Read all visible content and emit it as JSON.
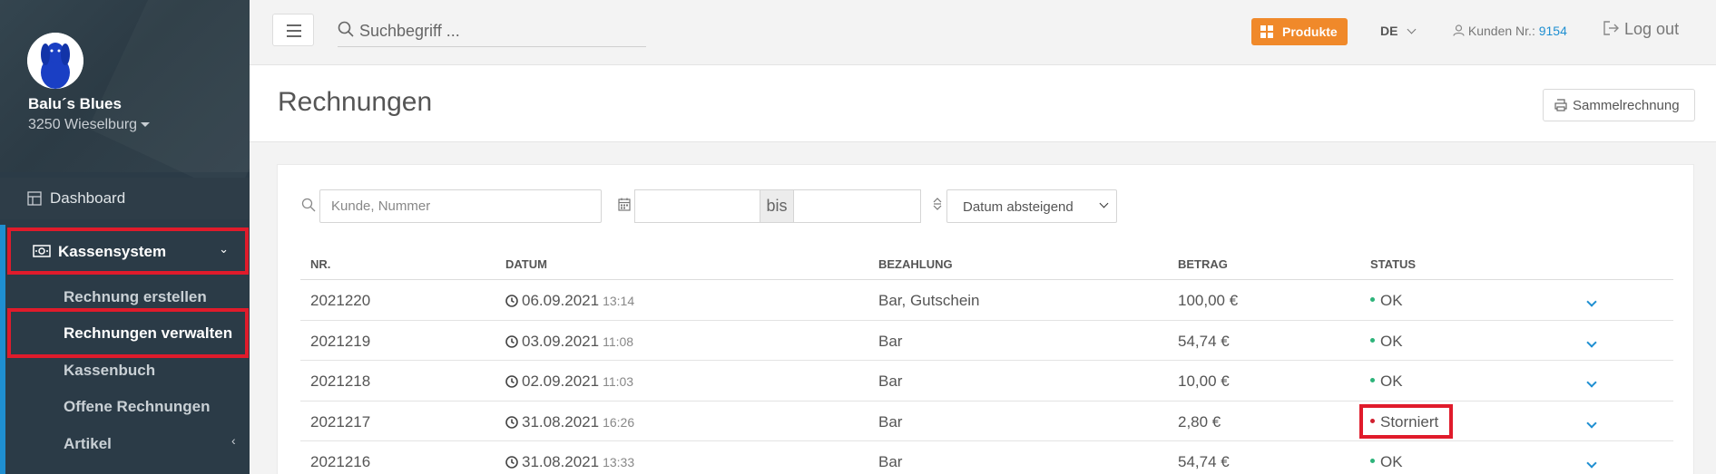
{
  "sidebar": {
    "brand_name": "Balu´s Blues",
    "brand_location": "3250 Wieselburg",
    "dashboard_label": "Dashboard",
    "kassensystem_label": "Kassensystem",
    "sub_items": [
      "Rechnung erstellen",
      "Rechnungen verwalten",
      "Kassenbuch",
      "Offene Rechnungen",
      "Artikel"
    ]
  },
  "topbar": {
    "search_placeholder": "Suchbegriff ...",
    "produkte_label": "Produkte",
    "language": "DE",
    "kunden_label": "Kunden Nr.:",
    "kunden_number": "9154",
    "logout_label": "Log out"
  },
  "header": {
    "title": "Rechnungen",
    "sammel_label": "Sammelrechnung"
  },
  "filters": {
    "search_placeholder": "Kunde, Nummer",
    "bis_label": "bis",
    "sort_value": "Datum absteigend"
  },
  "table": {
    "headers": {
      "nr": "NR.",
      "datum": "DATUM",
      "bezahlung": "BEZAHLUNG",
      "betrag": "BETRAG",
      "status": "STATUS"
    },
    "rows": [
      {
        "nr": "2021220",
        "date": "06.09.2021",
        "time": "13:14",
        "bezahlung": "Bar, Gutschein",
        "betrag": "100,00 €",
        "status": "OK"
      },
      {
        "nr": "2021219",
        "date": "03.09.2021",
        "time": "11:08",
        "bezahlung": "Bar",
        "betrag": "54,74 €",
        "status": "OK"
      },
      {
        "nr": "2021218",
        "date": "02.09.2021",
        "time": "11:03",
        "bezahlung": "Bar",
        "betrag": "10,00 €",
        "status": "OK"
      },
      {
        "nr": "2021217",
        "date": "31.08.2021",
        "time": "16:26",
        "bezahlung": "Bar",
        "betrag": "2,80 €",
        "status": "Storniert"
      },
      {
        "nr": "2021216",
        "date": "31.08.2021",
        "time": "13:33",
        "bezahlung": "Bar",
        "betrag": "54,74 €",
        "status": "OK"
      }
    ]
  },
  "colors": {
    "sidebar_bg": "#2b3b47",
    "accent_blue": "#1f8fd1",
    "produkte_orange": "#f0892a",
    "highlight_red": "#e01b2b",
    "status_ok": "#2db37a",
    "status_storniert": "#d0202e"
  }
}
